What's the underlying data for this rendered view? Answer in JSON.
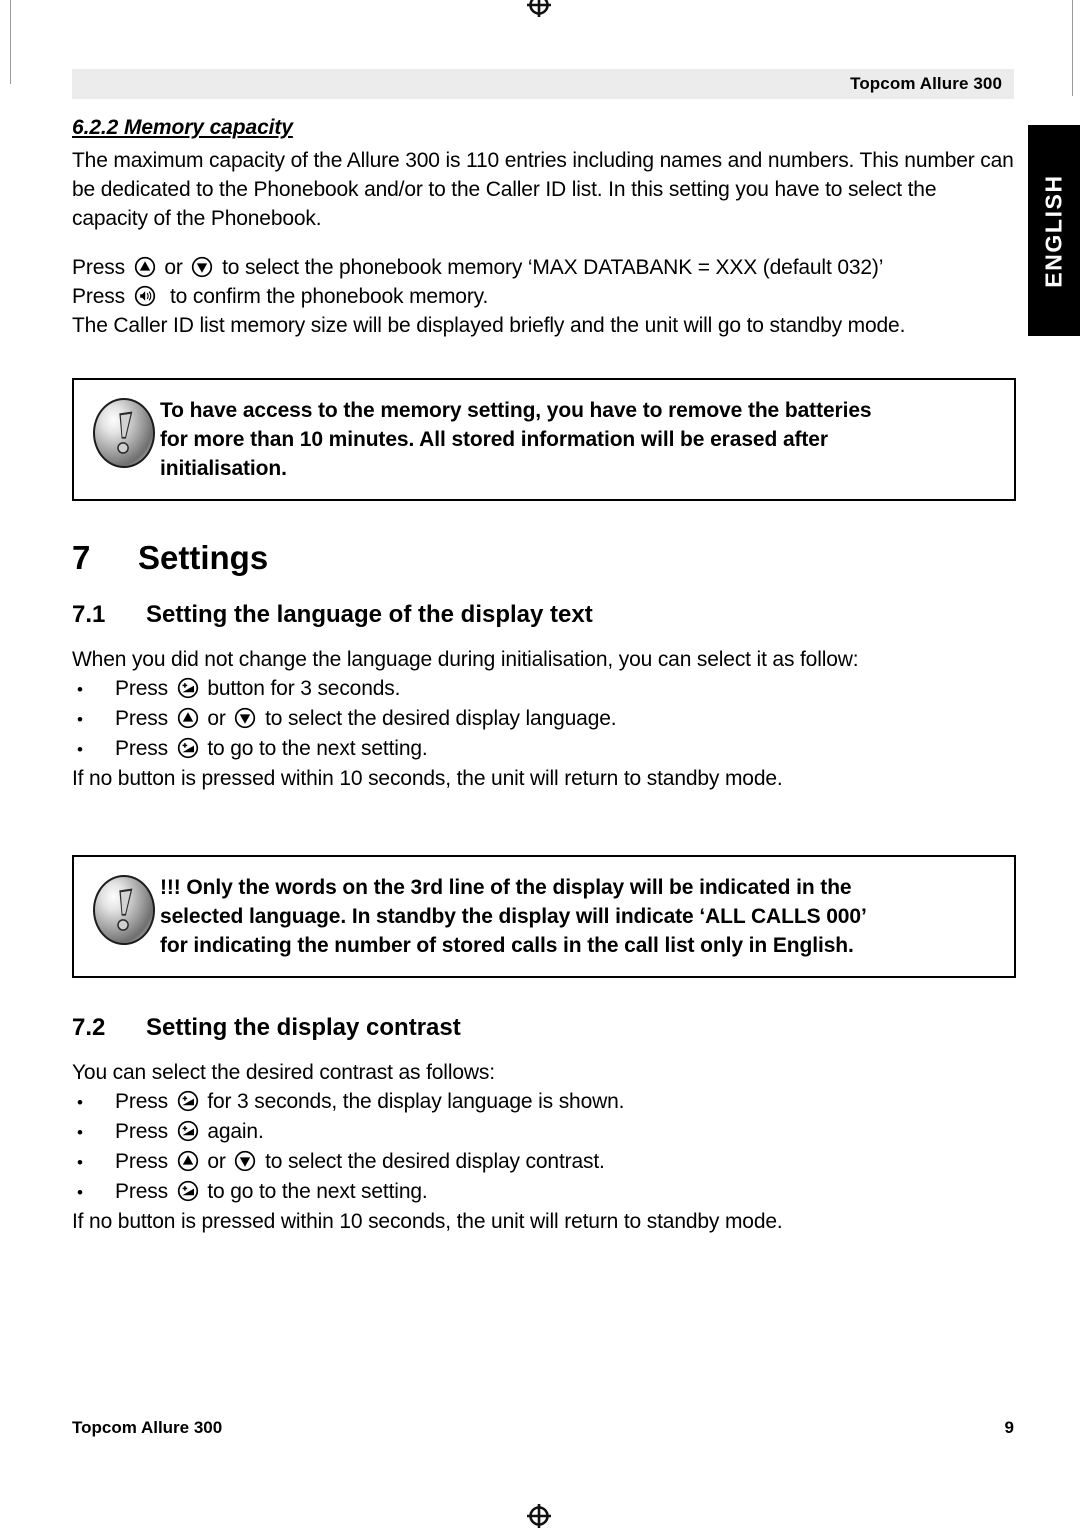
{
  "header": {
    "title": "Topcom Allure 300"
  },
  "language_tab": {
    "label": "ENGLISH"
  },
  "sections": {
    "memory_capacity": {
      "heading": "6.2.2 Memory capacity",
      "paragraph": "The maximum capacity of the Allure 300 is 110 entries including names and numbers. This number can be dedicated to the Phonebook and/or to the Caller ID list. In this setting you have to select the capacity of the Phonebook.",
      "press_up_down": {
        "press_label": "Press",
        "or_label": "or",
        "tail": "to select the phonebook memory ‘MAX DATABANK = XXX (default 032)’"
      },
      "press_confirm": {
        "press_label": "Press",
        "tail": "to confirm the phonebook memory."
      },
      "closing": "The Caller ID list memory size will be displayed briefly and the unit will go to standby mode."
    },
    "note_memory": {
      "line1": "To have access to the memory setting, you have to remove the batteries",
      "line2": "for more than 10 minutes. All stored information will be erased after",
      "line3": "initialisation."
    },
    "settings": {
      "number": "7",
      "title": "Settings"
    },
    "language_setting": {
      "number": "7.1",
      "title": "Setting the language of the display text",
      "intro": "When you did not change the language during initialisation, you can select it as follow:",
      "bullets": [
        {
          "press": "Press",
          "icon": "volume-up-key",
          "tail": "button for 3 seconds."
        },
        {
          "press": "Press",
          "icon": "up-key",
          "or": "or",
          "icon2": "down-key",
          "tail": "to select the desired display language."
        },
        {
          "press": "Press",
          "icon": "volume-up-key",
          "tail": "to go to the next setting."
        }
      ],
      "closing": "If no button is pressed within 10 seconds, the unit will return to standby mode."
    },
    "note_language": {
      "line1": "!!! Only the words on the 3rd line of the display will be indicated in the",
      "line2": "selected language. In standby the display will indicate ‘ALL CALLS 000’",
      "line3": "for indicating the number of stored calls in the call list only in English."
    },
    "contrast_setting": {
      "number": "7.2",
      "title": "Setting the display contrast",
      "intro": "You can select the desired contrast as follows:",
      "bullets": [
        {
          "press": "Press",
          "icon": "volume-up-key",
          "tail": "for 3 seconds, the display language is shown."
        },
        {
          "press": "Press",
          "icon": "volume-up-key",
          "tail": "again."
        },
        {
          "press": "Press",
          "icon": "up-key",
          "or": "or",
          "icon2": "down-key",
          "tail": "to select the desired display contrast."
        },
        {
          "press": "Press",
          "icon": "volume-up-key",
          "tail": "to go to the next setting."
        }
      ],
      "closing": "If no button is pressed within 10 seconds, the unit will return to standby mode."
    }
  },
  "bullet_char": "•",
  "footer": {
    "left": "Topcom Allure 300",
    "page_number": "9"
  }
}
